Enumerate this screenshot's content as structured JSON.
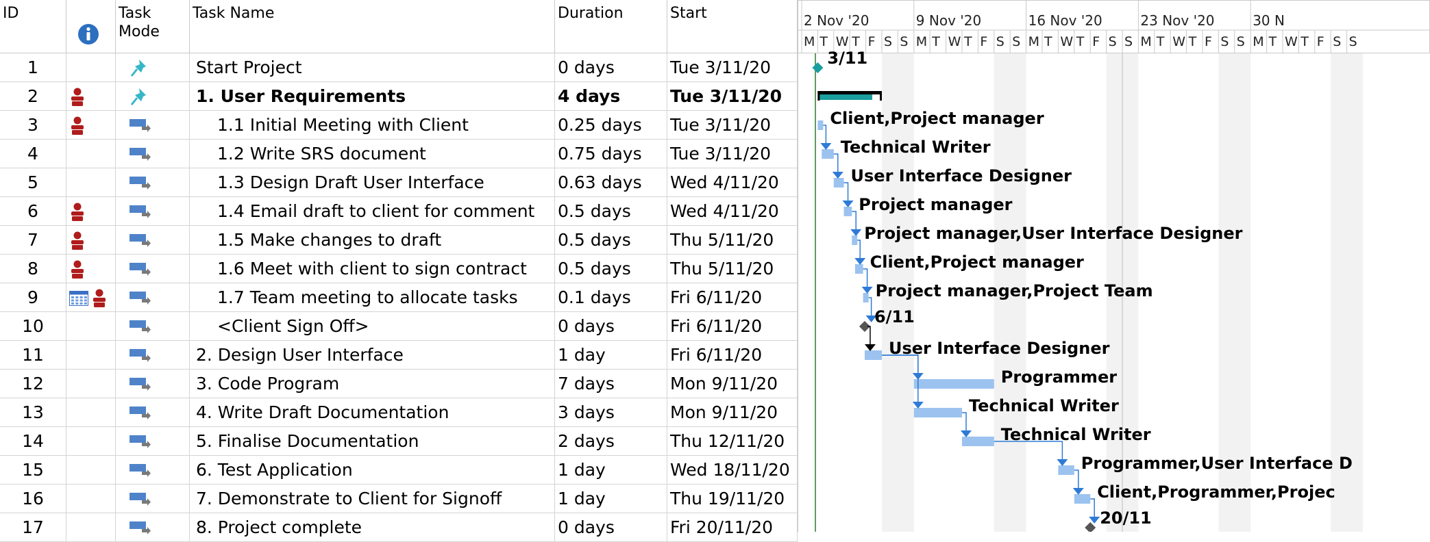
{
  "columns": {
    "id": "ID",
    "mode_line1": "Task",
    "mode_line2": "Mode",
    "name": "Task Name",
    "duration": "Duration",
    "start": "Start"
  },
  "tasks": [
    {
      "id": "1",
      "name": "Start Project",
      "duration": "0 days",
      "start": "Tue 3/11/20",
      "mode": "manual",
      "indicators": [],
      "summary": false,
      "indent": 0
    },
    {
      "id": "2",
      "name": "1. User Requirements",
      "duration": "4 days",
      "start": "Tue 3/11/20",
      "mode": "manual",
      "indicators": [
        "person-icon"
      ],
      "summary": true,
      "indent": 0
    },
    {
      "id": "3",
      "name": "1.1 Initial Meeting with Client",
      "duration": "0.25 days",
      "start": "Tue 3/11/20",
      "mode": "auto",
      "indicators": [
        "person-icon"
      ],
      "summary": false,
      "indent": 1
    },
    {
      "id": "4",
      "name": "1.2 Write SRS document",
      "duration": "0.75 days",
      "start": "Tue 3/11/20",
      "mode": "auto",
      "indicators": [],
      "summary": false,
      "indent": 1
    },
    {
      "id": "5",
      "name": "1.3 Design Draft User Interface",
      "duration": "0.63 days",
      "start": "Wed 4/11/20",
      "mode": "auto",
      "indicators": [],
      "summary": false,
      "indent": 1
    },
    {
      "id": "6",
      "name": "1.4 Email draft to client for comment",
      "duration": "0.5 days",
      "start": "Wed 4/11/20",
      "mode": "auto",
      "indicators": [
        "person-icon"
      ],
      "summary": false,
      "indent": 1
    },
    {
      "id": "7",
      "name": "1.5 Make changes to draft",
      "duration": "0.5 days",
      "start": "Thu 5/11/20",
      "mode": "auto",
      "indicators": [
        "person-icon"
      ],
      "summary": false,
      "indent": 1
    },
    {
      "id": "8",
      "name": "1.6 Meet with client to sign contract",
      "duration": "0.5 days",
      "start": "Thu 5/11/20",
      "mode": "auto",
      "indicators": [
        "person-icon"
      ],
      "summary": false,
      "indent": 1
    },
    {
      "id": "9",
      "name": "1.7 Team meeting to allocate tasks",
      "duration": "0.1 days",
      "start": "Fri 6/11/20",
      "mode": "auto",
      "indicators": [
        "calendar-icon",
        "person-icon"
      ],
      "summary": false,
      "indent": 1
    },
    {
      "id": "10",
      "name": "<Client Sign Off>",
      "duration": "0 days",
      "start": "Fri 6/11/20",
      "mode": "auto",
      "indicators": [],
      "summary": false,
      "indent": 1
    },
    {
      "id": "11",
      "name": "2. Design User Interface",
      "duration": "1 day",
      "start": "Fri 6/11/20",
      "mode": "auto",
      "indicators": [],
      "summary": false,
      "indent": 0
    },
    {
      "id": "12",
      "name": "3. Code Program",
      "duration": "7 days",
      "start": "Mon 9/11/20",
      "mode": "auto",
      "indicators": [],
      "summary": false,
      "indent": 0
    },
    {
      "id": "13",
      "name": "4. Write Draft Documentation",
      "duration": "3 days",
      "start": "Mon 9/11/20",
      "mode": "auto",
      "indicators": [],
      "summary": false,
      "indent": 0
    },
    {
      "id": "14",
      "name": "5. Finalise Documentation",
      "duration": "2 days",
      "start": "Thu 12/11/20",
      "mode": "auto",
      "indicators": [],
      "summary": false,
      "indent": 0
    },
    {
      "id": "15",
      "name": "6. Test Application",
      "duration": "1 day",
      "start": "Wed 18/11/20",
      "mode": "auto",
      "indicators": [],
      "summary": false,
      "indent": 0
    },
    {
      "id": "16",
      "name": "7. Demonstrate to Client for Signoff",
      "duration": "1 day",
      "start": "Thu 19/11/20",
      "mode": "auto",
      "indicators": [],
      "summary": false,
      "indent": 0
    },
    {
      "id": "17",
      "name": "8. Project complete",
      "duration": "0 days",
      "start": "Fri 20/11/20",
      "mode": "auto",
      "indicators": [],
      "summary": false,
      "indent": 0
    }
  ],
  "timescale": {
    "weeks": [
      "2 Nov '20",
      "9 Nov '20",
      "16 Nov '20",
      "23 Nov '20",
      "30 N"
    ],
    "day_letters": [
      "M",
      "T",
      "W",
      "T",
      "F",
      "S",
      "S"
    ]
  },
  "gantt_items": [
    {
      "row": 0,
      "kind": "milestone",
      "day": 1.0,
      "label": "3/11",
      "color": "#1a9e9e"
    },
    {
      "row": 1,
      "kind": "summary",
      "start": 1.0,
      "end": 5.0,
      "label": ""
    },
    {
      "row": 2,
      "kind": "bar",
      "start": 1.0,
      "end": 1.25,
      "label": "Client,Project manager"
    },
    {
      "row": 3,
      "kind": "bar",
      "start": 1.25,
      "end": 2.0,
      "label": "Technical Writer"
    },
    {
      "row": 4,
      "kind": "bar",
      "start": 2.0,
      "end": 2.63,
      "label": "User Interface Designer"
    },
    {
      "row": 5,
      "kind": "bar",
      "start": 2.63,
      "end": 3.13,
      "label": "Project manager"
    },
    {
      "row": 6,
      "kind": "bar",
      "start": 3.13,
      "end": 3.33,
      "label": "Project manager,User Interface Designer"
    },
    {
      "row": 7,
      "kind": "bar",
      "start": 3.33,
      "end": 3.83,
      "label": "Client,Project manager"
    },
    {
      "row": 8,
      "kind": "bar",
      "start": 3.83,
      "end": 3.93,
      "label": "Project manager,Project Team"
    },
    {
      "row": 9,
      "kind": "milestone",
      "day": 3.93,
      "label": "6/11",
      "color": "#555555"
    },
    {
      "row": 10,
      "kind": "bar",
      "start": 3.93,
      "end": 5.0,
      "label": "User Interface Designer"
    },
    {
      "row": 11,
      "kind": "bar",
      "start": 7.0,
      "end": 12.0,
      "label": "Programmer"
    },
    {
      "row": 12,
      "kind": "bar",
      "start": 7.0,
      "end": 10.0,
      "label": "Technical Writer"
    },
    {
      "row": 13,
      "kind": "bar",
      "start": 10.0,
      "end": 12.0,
      "label": "Technical Writer"
    },
    {
      "row": 14,
      "kind": "bar",
      "start": 16.0,
      "end": 17.0,
      "label": "Programmer,User Interface D"
    },
    {
      "row": 15,
      "kind": "bar",
      "start": 17.0,
      "end": 18.0,
      "label": "Client,Programmer,Projec"
    },
    {
      "row": 16,
      "kind": "milestone",
      "day": 18.0,
      "label": "20/11",
      "color": "#555555"
    }
  ],
  "colors": {
    "bar": "#9cc3f0",
    "bar_border": "#5b9bd5",
    "link": "#2e7bd6",
    "summary": "#1a9e9e",
    "weekend": "#f2f2f2",
    "person": "#b01c1c",
    "info": "#2c6fbf"
  },
  "info_icon": "i"
}
